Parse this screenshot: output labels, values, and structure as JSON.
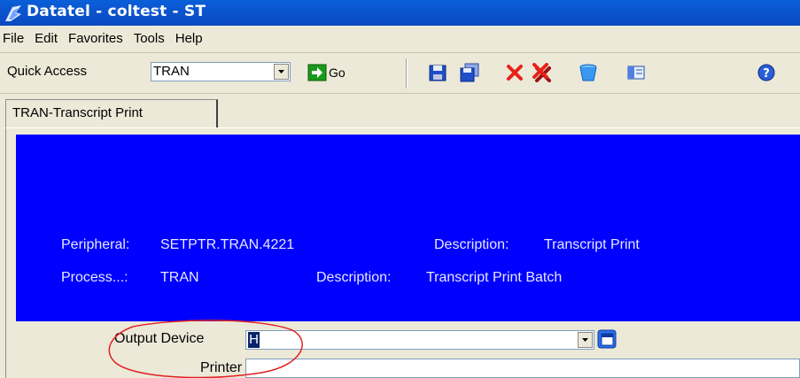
{
  "window": {
    "title": "Datatel - coltest - ST"
  },
  "menu": {
    "items": [
      "File",
      "Edit",
      "Favorites",
      "Tools",
      "Help"
    ]
  },
  "toolbar": {
    "quick_access_label": "Quick Access",
    "quick_access_value": "TRAN",
    "go_label": "Go",
    "icons": [
      "save-icon",
      "save-all-icon",
      "cancel-icon",
      "cancel-all-icon",
      "delete-icon",
      "form-icon",
      "help-icon"
    ]
  },
  "tab": {
    "label": "TRAN-Transcript Print"
  },
  "header": {
    "peripheral_label": "Peripheral:",
    "peripheral_value": "SETPTR.TRAN.4221",
    "peripheral_desc_label": "Description:",
    "peripheral_desc_value": "Transcript Print",
    "process_label": "Process...:",
    "process_value": "TRAN",
    "process_desc_label": "Description:",
    "process_desc_value": "Transcript Print Batch"
  },
  "form": {
    "output_device_label": "Output Device",
    "output_device_value": "H",
    "printer_label": "Printer",
    "printer_value": ""
  },
  "colors": {
    "titlebar": "#0a55d0",
    "panel": "#0000ff",
    "annotation": "#e02020"
  }
}
